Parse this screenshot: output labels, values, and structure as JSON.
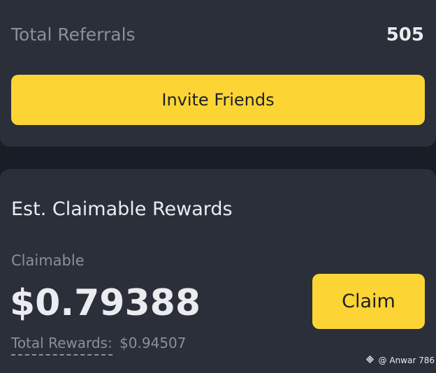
{
  "referrals": {
    "label": "Total Referrals",
    "count": "505",
    "invite_button": "Invite Friends"
  },
  "rewards": {
    "section_title": "Est. Claimable Rewards",
    "claimable_label": "Claimable",
    "claimable_amount": "$0.79388",
    "claim_button": "Claim",
    "total_label": "Total Rewards:",
    "total_value": "$0.94507"
  },
  "watermark": {
    "icon": "binance-diamond-icon",
    "text": "@ Anwar 786"
  },
  "colors": {
    "accent": "#fcd535",
    "card": "#2a2f3a",
    "background": "#181d26",
    "primary_text": "#eaecef",
    "secondary_text": "#8a909c"
  }
}
